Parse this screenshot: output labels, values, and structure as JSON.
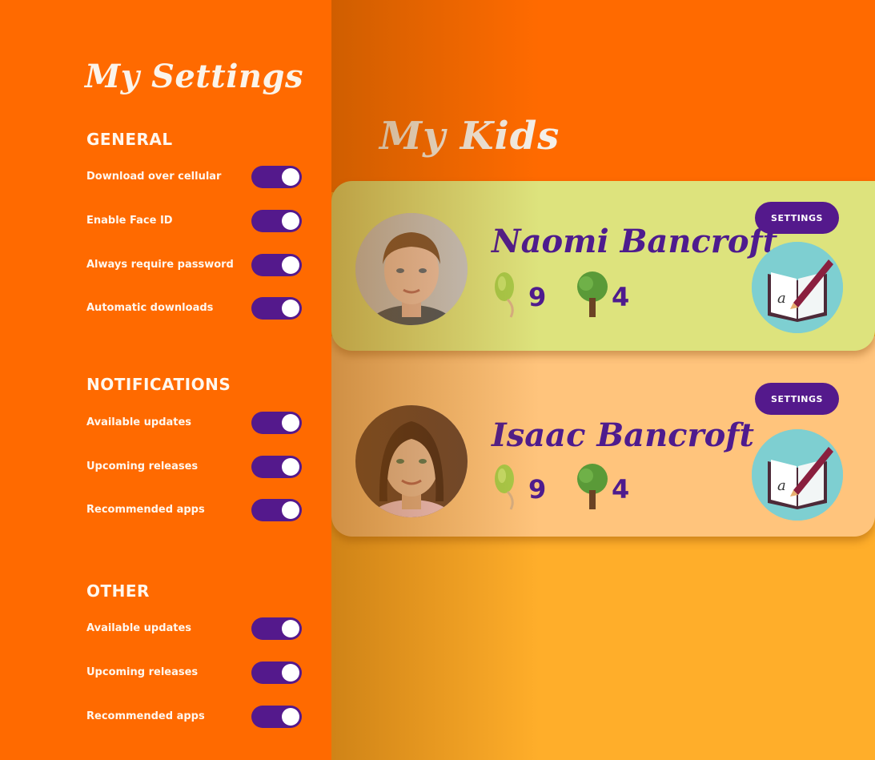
{
  "sidebar": {
    "title": "My Settings",
    "sections": [
      {
        "title": "GENERAL",
        "items": [
          {
            "label": "Download over cellular",
            "on": true
          },
          {
            "label": "Enable Face ID",
            "on": true
          },
          {
            "label": "Always require password",
            "on": true
          },
          {
            "label": "Automatic downloads",
            "on": true
          }
        ]
      },
      {
        "title": "NOTIFICATIONS",
        "items": [
          {
            "label": "Available updates",
            "on": true
          },
          {
            "label": "Upcoming releases",
            "on": true
          },
          {
            "label": "Recommended apps",
            "on": true
          }
        ]
      },
      {
        "title": "OTHER",
        "items": [
          {
            "label": "Available updates",
            "on": true
          },
          {
            "label": "Upcoming releases",
            "on": true
          },
          {
            "label": "Recommended apps",
            "on": true
          }
        ]
      }
    ]
  },
  "main": {
    "title": "My Kids",
    "kids": [
      {
        "name": "Naomi Bancroft",
        "seeds": "9",
        "trees": "4",
        "settings_label": "SETTINGS",
        "app_icon": "writing-book-icon"
      },
      {
        "name": "Isaac Bancroft",
        "seeds": "9",
        "trees": "4",
        "settings_label": "SETTINGS",
        "app_icon": "writing-book-icon"
      }
    ]
  },
  "colors": {
    "sidebar_bg": "#ff6a00",
    "header_bg": "#ff6a00",
    "main_bg": "#ffae2a",
    "card_1_bg": "#dde37d",
    "card_2_bg": "#ffc47c",
    "accent_purple": "#54198c",
    "name_purple": "#4e1b8e"
  }
}
